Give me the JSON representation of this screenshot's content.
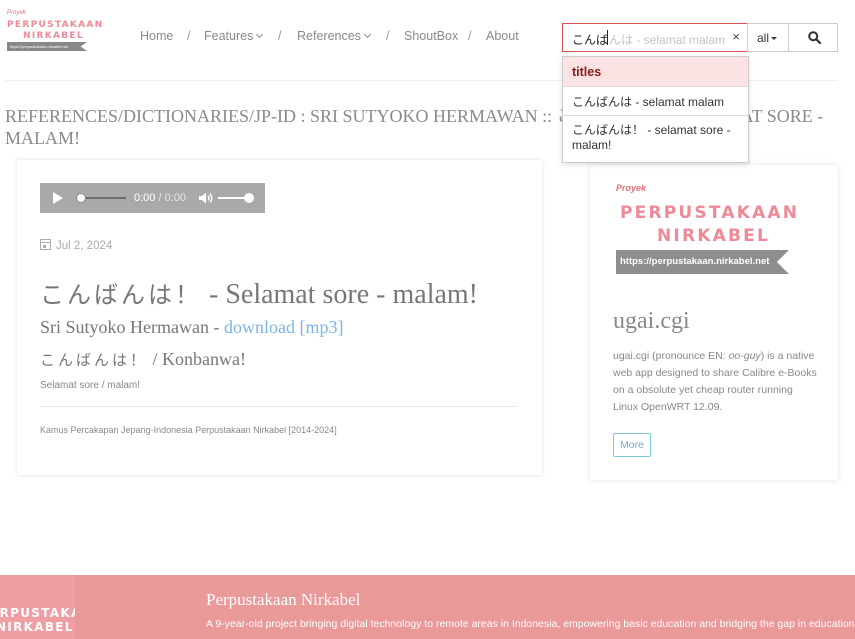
{
  "brand": {
    "proyek": "Proyek",
    "line1": "PERPUSTAKAAN",
    "line2": "NIRKABEL",
    "url": "https://perpustakaan.nirkabel.net"
  },
  "nav": {
    "items": [
      "Home",
      "Features",
      "References",
      "ShoutBox",
      "About"
    ],
    "separator": "/"
  },
  "search": {
    "typed": "こんば",
    "ghost_completion": "んは - selamat malam",
    "clear": "×",
    "scope": "all",
    "suggestions": {
      "group": "titles",
      "options": [
        "こんばんは - selamat malam",
        "こんばんは！ - selamat sore - malam!"
      ]
    }
  },
  "page_heading": "REFERENCES/DICTIONARIES/JP-ID : SRI SUTYOKO HERMAWAN :: こんばんは！ - SELAMAT SORE - MALAM!",
  "audio": {
    "time": "0:00",
    "duration": "/ 0:00"
  },
  "entry": {
    "date": "Jul 2, 2024",
    "title_jp": "こんばんは！",
    "title_rest": " - Selamat sore - malam!",
    "author": "Sri Sutyoko Hermawan - ",
    "download_label": "download [mp3]",
    "romaji_jp": "こんばんは！",
    "romaji_rest": " / Konbanwa!",
    "meaning": "Selamat sore / malam!",
    "source": "Kamus Percakapan Jepang-Indonesia Perpustakaan Nirkabel [2014-2024]"
  },
  "side": {
    "brand_proyek": "Proyek",
    "brand_line1": "PERPUSTAKAAN",
    "brand_line2": "NIRKABEL",
    "brand_url": "https://perpustakaan.nirkabel.net",
    "title": "ugai.cgi",
    "text_before": "ugai.cgi (pronounce EN: ",
    "text_italic": "oo-guy",
    "text_after": ") is a native web app designed to share Calibre e-Books on a obsolute yet cheap router running Linux OpenWRT 12.09.",
    "more_label": "More"
  },
  "footer": {
    "logo_line1": "PERPUSTAKAAN",
    "logo_line2": "NIRKABEL",
    "title": "Perpustakaan Nirkabel",
    "desc": "A 9-year-old project bringing digital technology to remote areas in Indonesia, empowering basic education and bridging the gap in education"
  },
  "colors": {
    "accent_red": "#d9534f",
    "link_blue": "#7cb5e6",
    "brand_pink": "#ee8a98",
    "footer_bg": "#ea9999"
  }
}
